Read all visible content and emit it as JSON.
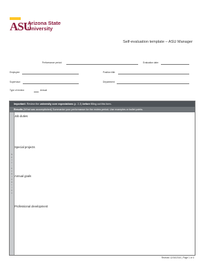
{
  "logo": {
    "mark": "ASU",
    "name_line1": "Arizona State",
    "name_line2": "University"
  },
  "document_title": "Self-evaluation template – ASU Manager",
  "fields": {
    "performance_period": "Performance period:",
    "evaluation_date": "Evaluation date:",
    "employee": "Employee:",
    "position_title": "Position title:",
    "supervisor": "Supervisor:",
    "department": "Department:",
    "type_of_review": "Type of review:",
    "annual": "Annual"
  },
  "banner": {
    "important_label": "Important:",
    "important_text": "Review the",
    "important_bold": "university core expectations",
    "important_text2": "(p. 2,3)",
    "important_bold2": "before",
    "important_text3": "filling out this form."
  },
  "results_bar": {
    "label": "Results",
    "label_detail": "(What was accomplished)",
    "text": "Summarize your performance for the review period. Use examples or bullet points."
  },
  "side_label": [
    "S",
    "e",
    "l",
    "f",
    "-",
    "e",
    "v",
    "a",
    "l",
    "u",
    "a",
    "t",
    "i",
    "o",
    "n"
  ],
  "sections": {
    "job_duties": "Job duties",
    "special_projects": "Special projects",
    "annual_goals": "Annual goals",
    "professional_development": "Professional development"
  },
  "footer": "Revised 12/16/2016 | Page 1 of 4"
}
